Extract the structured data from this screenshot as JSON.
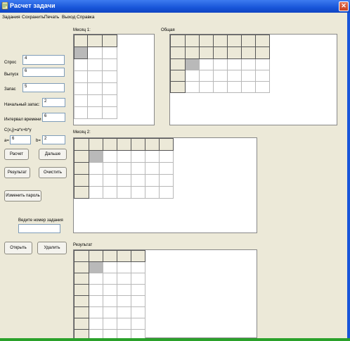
{
  "window": {
    "title": "Расчет задачи",
    "close_glyph": "✕"
  },
  "menu": [
    "Задания",
    "Сохранить",
    "Печать",
    "Выход",
    "Справка"
  ],
  "form": {
    "demand_label": "Спрос",
    "demand_value": "4",
    "output_label": "Выпуск",
    "output_value": "6",
    "stock_label": "Запас",
    "stock_value": "5",
    "init_stock_label": "Начальный запас:",
    "init_stock_value": "2",
    "interval_label": "Интервал времени",
    "interval_value": "6",
    "formula_label": "C(x,j)=a*x+b*y",
    "a_label": "a=",
    "a_value": "6",
    "b_label": "b=",
    "b_value": "2",
    "task_number_label": "Ведите номер задания",
    "task_number_value": ""
  },
  "buttons": {
    "calc": "Расчет",
    "next": "Дальше",
    "result": "Результат",
    "clear": "Очистить",
    "change_password": "Изменить пароль",
    "open": "Открыть",
    "delete": "Удалить"
  },
  "grids": {
    "month1": "Месяц 1:",
    "general": "Общая",
    "month2": "Месяц 2:",
    "result": "Результат"
  },
  "colors": {
    "titlebar": "#1855d9",
    "face": "#ece9d8",
    "status_strip": "#2aa12a"
  }
}
